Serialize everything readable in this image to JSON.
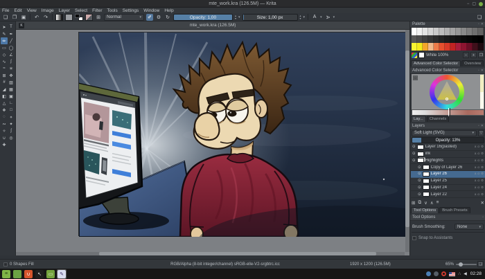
{
  "window": {
    "title": "mte_work.kra (126.5M) — Krita"
  },
  "menu": {
    "items": [
      "File",
      "Edit",
      "View",
      "Image",
      "Layer",
      "Select",
      "Filter",
      "Tools",
      "Settings",
      "Window",
      "Help"
    ]
  },
  "icons": {
    "minimize": "−",
    "maximize": "▢",
    "new_doc": "❏",
    "open": "❐",
    "save": "▣",
    "undo": "↶",
    "redo": "↷",
    "preset_grid": "⊞",
    "eraser": "✐",
    "gear": "⚙",
    "reload": "↻",
    "caret": "▾",
    "spin_up": "▴",
    "spin_down": "▾",
    "mirror_h": "A",
    "mirror_v": "A",
    "workspace": "❏",
    "float": "▫",
    "close": "✕",
    "filter": "▽",
    "eye": "⊙",
    "minus": "−",
    "plus": "+",
    "folder": "❐",
    "settings_small": "▤",
    "krita_file": "K",
    "selection_box": "▫",
    "canvas_only": "❏",
    "layer_badges": [
      "a",
      "α",
      "⚙"
    ]
  },
  "toolbar": {
    "blend_mode": "Normal",
    "opacity_label": "Opacity: 1,00",
    "size_label": "Size: 1,00 px"
  },
  "toolbox": {
    "tools": [
      {
        "name": "select-shapes",
        "glyph": "➤"
      },
      {
        "name": "text",
        "glyph": "T"
      },
      {
        "name": "edit-shapes",
        "glyph": "✎"
      },
      {
        "name": "calligraphy",
        "glyph": "✒"
      },
      {
        "name": "freehand-brush",
        "glyph": "✏",
        "active": true
      },
      {
        "name": "line",
        "glyph": "╱"
      },
      {
        "name": "rectangle",
        "glyph": "▭"
      },
      {
        "name": "ellipse",
        "glyph": "◯"
      },
      {
        "name": "polygon",
        "glyph": "◇"
      },
      {
        "name": "polyline",
        "glyph": "∠"
      },
      {
        "name": "bezier-curve",
        "glyph": "∿"
      },
      {
        "name": "freehand-path",
        "glyph": "∫"
      },
      {
        "name": "dynamic-brush",
        "glyph": "≈"
      },
      {
        "name": "multibrush",
        "glyph": "✳"
      },
      {
        "name": "transform",
        "glyph": "⊞"
      },
      {
        "name": "move",
        "glyph": "✥"
      },
      {
        "name": "crop",
        "glyph": "#"
      },
      {
        "name": "gradient",
        "glyph": "▨"
      },
      {
        "name": "color-sampler",
        "glyph": "◢"
      },
      {
        "name": "pattern-edit",
        "glyph": "▦"
      },
      {
        "name": "fill",
        "glyph": "◧"
      },
      {
        "name": "enclose-fill",
        "glyph": "▣"
      },
      {
        "name": "assistants",
        "glyph": "△"
      },
      {
        "name": "measure",
        "glyph": "∟"
      },
      {
        "name": "reference-images",
        "glyph": "❖"
      },
      {
        "name": "rect-select",
        "glyph": "□"
      },
      {
        "name": "ellipse-select",
        "glyph": "◌"
      },
      {
        "name": "polygon-select",
        "glyph": "⋄"
      },
      {
        "name": "freehand-select",
        "glyph": "∾"
      },
      {
        "name": "contiguous-select",
        "glyph": "✦"
      },
      {
        "name": "similar-select",
        "glyph": "✧"
      },
      {
        "name": "bezier-select",
        "glyph": "ʃ"
      },
      {
        "name": "magnetic-select",
        "glyph": "∪"
      },
      {
        "name": "zoom",
        "glyph": "◎"
      },
      {
        "name": "pan",
        "glyph": "✚"
      }
    ]
  },
  "subwindow": {
    "title": "mte_work.kra (126.5M)"
  },
  "canvas": {
    "description": "Digital painting: tired cartoon man with messy brown hair and dark red t-shirt staring at a glowing computer monitor showing a webpage, light rays radiating into a dark blue room"
  },
  "palette": {
    "title": "Palette",
    "rows": [
      [
        "#ffffff",
        "#f1f1f1",
        "#e4e4e4",
        "#d7d7d7",
        "#cacaca",
        "#bdbdbd",
        "#b0b0b0",
        "#a3a3a3",
        "#969696",
        "#898989",
        "#7c7c7c",
        "#6f6f6f",
        "#626262"
      ],
      [
        "#565656",
        "#4b4b4b",
        "#404040",
        "#363636",
        "#2c2c2c",
        "#232323",
        "#1b1b1b",
        "#151515",
        "#101010",
        "#0b0b0b",
        "#070707",
        "#030303",
        "#000000"
      ],
      [
        "#f8f431",
        "#f3e91c",
        "#f5a62b",
        "#f2b98a",
        "#ee7c49",
        "#e6502e",
        "#d83a28",
        "#c12323",
        "#a71d3c",
        "#8d1430",
        "#6a0f27",
        "#3f101b",
        "#1c0a10"
      ]
    ],
    "selected_color_label": "White 100%"
  },
  "selector_tabs": {
    "advanced": "Advanced Color Selector",
    "overview": "Overview"
  },
  "advanced_color_selector": {
    "title": "Advanced Color Selector"
  },
  "layer_tabs": {
    "layers": "Lay...",
    "channels": "Channels"
  },
  "layers": {
    "title": "Layers",
    "blend_mode": "Soft Light (SVG)",
    "opacity_label": "Opacity: 13%",
    "opacity_percent": 13,
    "items": [
      {
        "name": "Layer 16(pasted)",
        "indent": 0,
        "group": false,
        "selected": false
      },
      {
        "name": "ink",
        "indent": 0,
        "group": false,
        "selected": false
      },
      {
        "name": "Highlights",
        "indent": 0,
        "group": true,
        "selected": false
      },
      {
        "name": "Copy of Layer 26",
        "indent": 1,
        "group": false,
        "selected": false
      },
      {
        "name": "Layer 26",
        "indent": 1,
        "group": false,
        "selected": true
      },
      {
        "name": "Layer 25",
        "indent": 1,
        "group": false,
        "selected": false
      },
      {
        "name": "Layer 24",
        "indent": 1,
        "group": false,
        "selected": false
      },
      {
        "name": "Layer 22",
        "indent": 1,
        "group": false,
        "selected": false
      }
    ],
    "buttons": [
      {
        "name": "add-layer",
        "glyph": "⊞"
      },
      {
        "name": "duplicate-layer",
        "glyph": "⧉"
      },
      {
        "name": "move-layer-down",
        "glyph": "∨"
      },
      {
        "name": "move-layer-up",
        "glyph": "∧"
      },
      {
        "name": "layer-properties",
        "glyph": "≡"
      },
      {
        "name": "delete-layer",
        "glyph": "✕"
      }
    ]
  },
  "bottom_tabs": {
    "tool_options": "Tool Options",
    "brush_presets": "Brush Presets"
  },
  "tool_options": {
    "title": "Tool Options",
    "brush_smoothing_label": "Brush Smoothing:",
    "brush_smoothing_value": "None",
    "snap_label": "Snap to Assistants"
  },
  "statusbar": {
    "selection": "0 Shapes Fill",
    "colorspace": "RGB/Alpha (8-bit integer/channel)  sRGB-elle-V2-srgbtrc.icc",
    "dimensions": "1920 x 1200 (126.5M)",
    "zoom": "65%"
  },
  "taskbar": {
    "clock": "02:28",
    "apps": [
      {
        "name": "mint-menu",
        "bg": "#7fb347",
        "glyph": "≡",
        "fg": "#274012"
      },
      {
        "name": "window-app",
        "bg": "#6ca244",
        "glyph": "",
        "fg": "#fff"
      },
      {
        "name": "orange-app",
        "bg": "#d6552d",
        "glyph": "∪",
        "fg": "#fff"
      },
      {
        "name": "screenshot-app",
        "bg": "#1f1f1f",
        "glyph": "↖",
        "fg": "#ddd"
      },
      {
        "name": "files-app",
        "bg": "#74a33e",
        "glyph": "▭",
        "fg": "#e8f0d8"
      },
      {
        "name": "krita-app",
        "bg": "#d9ddf0",
        "glyph": "✎",
        "fg": "#3b2d66",
        "active": true
      }
    ],
    "tray": [
      {
        "name": "update-shield-icon",
        "type": "dot",
        "color": "#4a7fb5"
      },
      {
        "name": "settings-tray-icon",
        "type": "dot",
        "color": "#565e67"
      },
      {
        "name": "record-icon",
        "type": "ring"
      },
      {
        "name": "keyboard-flag-icon",
        "type": "flag"
      },
      {
        "name": "network-icon",
        "type": "glyph",
        "glyph": "∴"
      },
      {
        "name": "volume-icon",
        "type": "glyph",
        "glyph": "◀"
      }
    ]
  },
  "colors": {
    "accent": "#5680a6",
    "selection": "#456a90",
    "canvas_bg": "#7d8084"
  }
}
